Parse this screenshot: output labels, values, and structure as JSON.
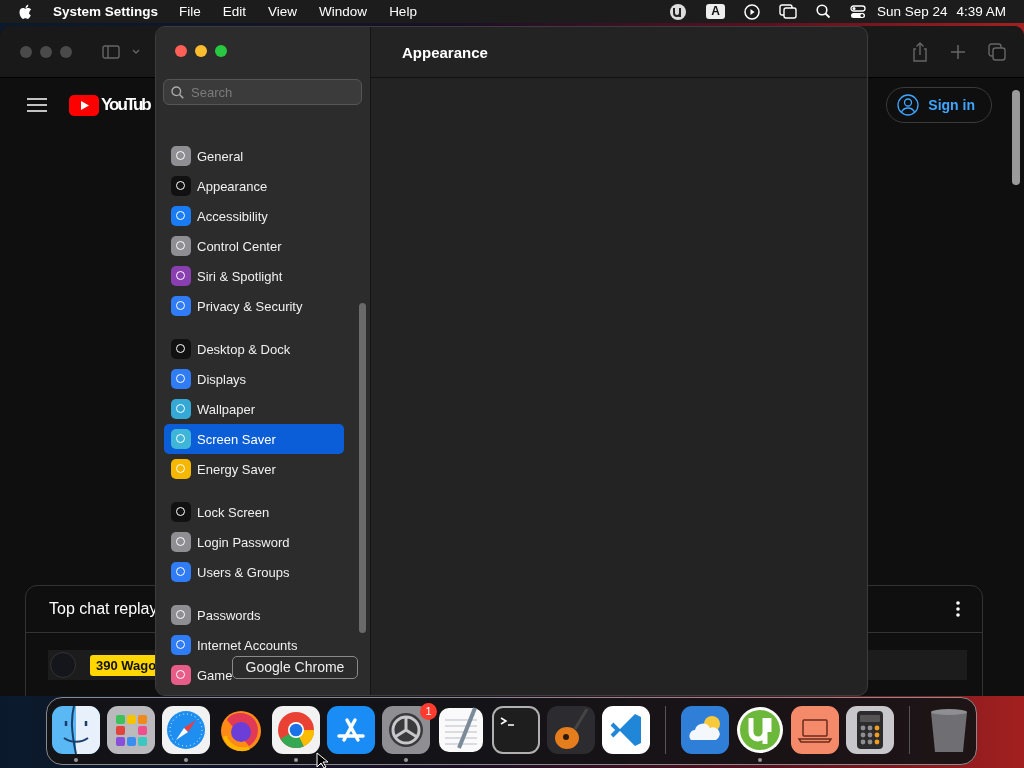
{
  "menubar": {
    "app_name": "System Settings",
    "menus": [
      "File",
      "Edit",
      "View",
      "Window",
      "Help"
    ],
    "input_source": "A",
    "date": "Sun Sep 24",
    "time": "4:39 AM"
  },
  "browser": {
    "logo_text": "YouTub",
    "sign_in": "Sign in",
    "chat": {
      "title": "Top chat replay",
      "rows": [
        {
          "badge": "390 Wago",
          "selected": true
        }
      ]
    }
  },
  "settings": {
    "title": "Appearance",
    "search": {
      "placeholder": "Search"
    },
    "groups": [
      {
        "items": [
          {
            "label": "General",
            "selected": false,
            "color": "#8e8e93"
          },
          {
            "label": "Appearance",
            "selected": false,
            "color": "#111111"
          },
          {
            "label": "Accessibility",
            "selected": false,
            "color": "#1a7cf5"
          },
          {
            "label": "Control Center",
            "selected": false,
            "color": "#8e8e93"
          },
          {
            "label": "Siri & Spotlight",
            "selected": false,
            "color": "#8a3fb0"
          },
          {
            "label": "Privacy & Security",
            "selected": false,
            "color": "#2f7cf6"
          }
        ]
      },
      {
        "items": [
          {
            "label": "Desktop & Dock",
            "selected": false,
            "color": "#111111"
          },
          {
            "label": "Displays",
            "selected": false,
            "color": "#2f7cf6"
          },
          {
            "label": "Wallpaper",
            "selected": false,
            "color": "#35a9d6"
          },
          {
            "label": "Screen Saver",
            "selected": true,
            "color": "#3fb5d8"
          },
          {
            "label": "Energy Saver",
            "selected": false,
            "color": "#f5b700"
          }
        ]
      },
      {
        "items": [
          {
            "label": "Lock Screen",
            "selected": false,
            "color": "#111111"
          },
          {
            "label": "Login Password",
            "selected": false,
            "color": "#8e8e93"
          },
          {
            "label": "Users & Groups",
            "selected": false,
            "color": "#2f7cf6"
          }
        ]
      },
      {
        "items": [
          {
            "label": "Passwords",
            "selected": false,
            "color": "#8e8e93"
          },
          {
            "label": "Internet Accounts",
            "selected": false,
            "color": "#2f7cf6"
          },
          {
            "label": "Game",
            "selected": false,
            "color": "#e85c8a"
          }
        ]
      }
    ]
  },
  "dock": {
    "tooltip": "Google Chrome",
    "groups": [
      {
        "apps": [
          {
            "kind": "finder",
            "running": true
          },
          {
            "kind": "launchpad",
            "running": false
          },
          {
            "kind": "safari",
            "running": true
          },
          {
            "kind": "firefox",
            "running": false
          },
          {
            "kind": "chrome",
            "running": true
          },
          {
            "kind": "appstore",
            "running": false
          },
          {
            "kind": "settings",
            "running": true,
            "badge": "1"
          },
          {
            "kind": "textedit",
            "running": false
          },
          {
            "kind": "terminal",
            "running": false
          },
          {
            "kind": "garageband",
            "running": false
          },
          {
            "kind": "vscode",
            "running": false
          }
        ]
      },
      {
        "apps": [
          {
            "kind": "weather",
            "running": false
          },
          {
            "kind": "utorrent",
            "running": true
          },
          {
            "kind": "laptop",
            "running": false
          },
          {
            "kind": "calculator",
            "running": false
          }
        ]
      },
      {
        "apps": [
          {
            "kind": "trash",
            "running": false
          }
        ]
      }
    ]
  }
}
